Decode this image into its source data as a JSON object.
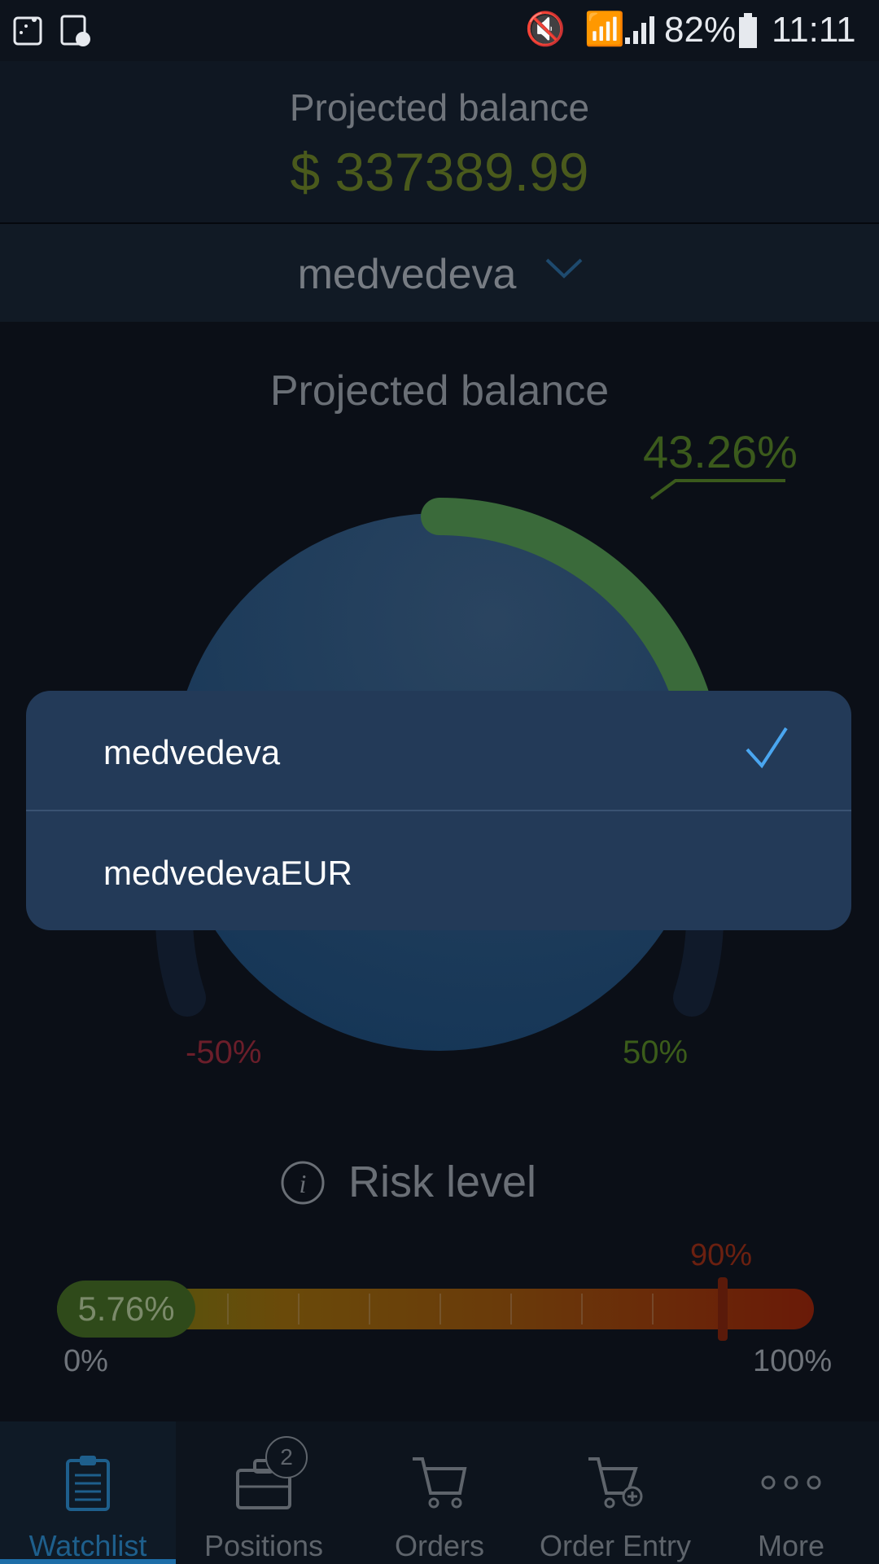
{
  "status_bar": {
    "battery": "82%",
    "time": "11:11"
  },
  "header": {
    "title": "Projected balance",
    "amount": "$ 337389.99"
  },
  "account_selector": {
    "selected": "medvedeva"
  },
  "gauge": {
    "title": "Projected balance",
    "value_label": "43.26%",
    "value": 43.26,
    "min_label": "-50%",
    "max_label": "50%"
  },
  "risk": {
    "title": "Risk level",
    "current_label": "5.76%",
    "current": 5.76,
    "threshold_label": "90%",
    "threshold": 90,
    "min_label": "0%",
    "max_label": "100%"
  },
  "dropdown": {
    "items": [
      {
        "label": "medvedeva",
        "selected": true
      },
      {
        "label": "medvedevaEUR",
        "selected": false
      }
    ]
  },
  "bottom_nav": {
    "items": [
      {
        "label": "Watchlist",
        "icon": "clipboard-icon",
        "active": true
      },
      {
        "label": "Positions",
        "icon": "briefcase-icon",
        "badge": "2"
      },
      {
        "label": "Orders",
        "icon": "cart-icon"
      },
      {
        "label": "Order Entry",
        "icon": "cart-plus-icon"
      },
      {
        "label": "More",
        "icon": "more-icon"
      }
    ]
  },
  "colors": {
    "accent": "#1e6ea8",
    "positive": "#3a6a3a",
    "negative": "#6b1e2a",
    "dropdown_bg": "#233a58"
  }
}
